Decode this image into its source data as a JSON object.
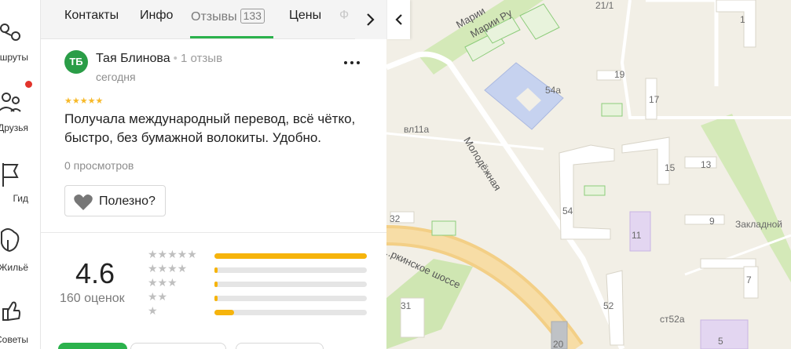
{
  "nav": {
    "items": [
      {
        "label": "Маршруты",
        "icon": "route-icon",
        "badge": false
      },
      {
        "label": "Друзья",
        "icon": "friends-icon",
        "badge": true
      },
      {
        "label": "Гид",
        "icon": "flag-icon",
        "badge": false
      },
      {
        "label": "Жильё",
        "icon": "building-icon",
        "badge": false
      },
      {
        "label": "Советы",
        "icon": "thumbs-up-icon",
        "badge": false
      }
    ]
  },
  "tabs": {
    "contacts": "Контакты",
    "info": "Инфо",
    "reviews": "Отзывы",
    "reviews_count": "133",
    "prices": "Цены",
    "truncated": "Ф"
  },
  "review": {
    "avatar_initials": "ТБ",
    "author": "Тая Блинова",
    "author_meta": "1 отзыв",
    "date": "сегодня",
    "stars": "★★★★★",
    "text": "Получала международный перевод, всё чётко, быстро, без бумажной волокиты. Удобно.",
    "views": "0 просмотров",
    "useful_label": "Полезно?"
  },
  "rating": {
    "value": "4.6",
    "count_label": "160 оценок",
    "distribution": [
      {
        "stars": 5,
        "star_text": "★★★★★",
        "fraction": 1.0
      },
      {
        "stars": 4,
        "star_text": "★★★★",
        "fraction": 0.02
      },
      {
        "stars": 3,
        "star_text": "★★★",
        "fraction": 0.02
      },
      {
        "stars": 2,
        "star_text": "★★",
        "fraction": 0.02
      },
      {
        "stars": 1,
        "star_text": "★",
        "fraction": 0.13
      }
    ]
  },
  "map": {
    "streets": [
      "Марии",
      "Марии Ру",
      "Молодёжная",
      "...ркинское шоссе"
    ],
    "labels": [
      "21/1",
      "1",
      "54а",
      "19",
      "17",
      "вл11а",
      "15",
      "13",
      "54",
      "9",
      "11",
      "Закладной",
      "7",
      "32",
      "52",
      "31",
      "ст52а",
      "5",
      "20"
    ]
  },
  "colors": {
    "accent": "#2bb24c",
    "star": "#f6b40c",
    "badge": "#e2342c",
    "avatar": "#2a9d47"
  }
}
